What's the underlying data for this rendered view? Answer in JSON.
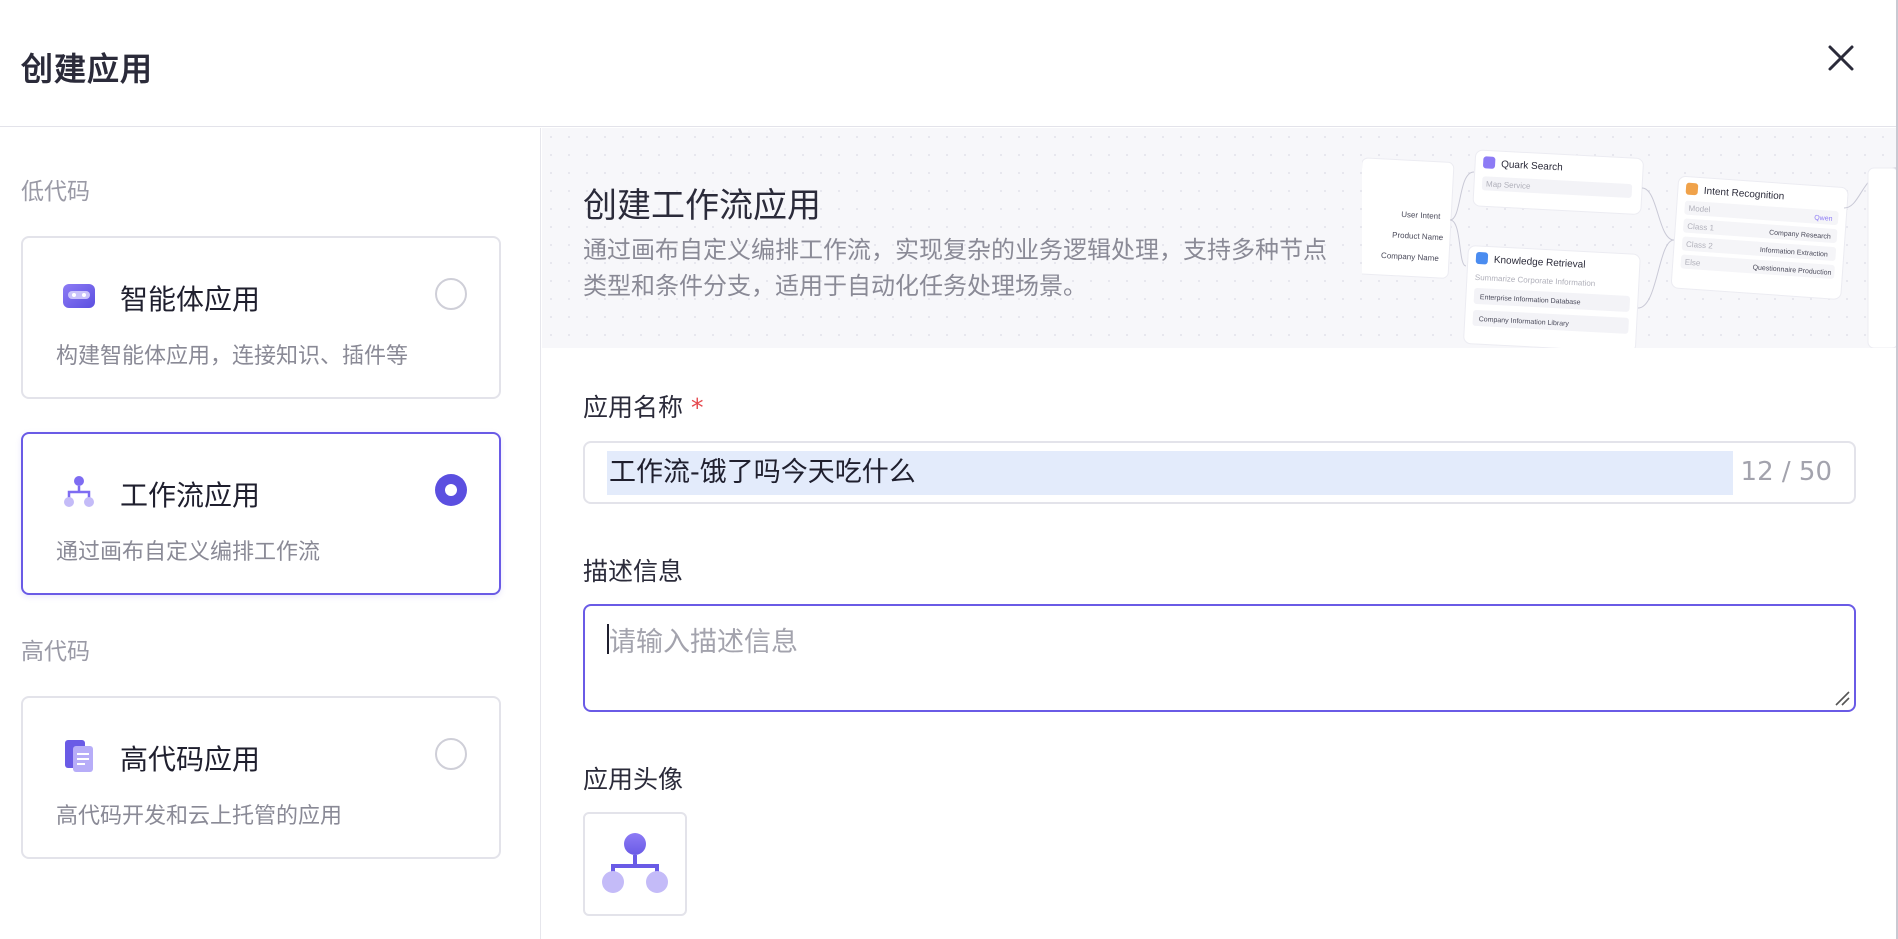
{
  "dialog": {
    "title": "创建应用",
    "close_icon": "close-icon"
  },
  "sidebar": {
    "low_code_label": "低代码",
    "high_code_label": "高代码",
    "cards": [
      {
        "title": "智能体应用",
        "desc": "构建智能体应用，连接知识、插件等",
        "icon": "agent-icon",
        "selected": false
      },
      {
        "title": "工作流应用",
        "desc": "通过画布自定义编排工作流",
        "icon": "workflow-icon",
        "selected": true
      },
      {
        "title": "高代码应用",
        "desc": "高代码开发和云上托管的应用",
        "icon": "code-document-icon",
        "selected": false
      }
    ]
  },
  "banner": {
    "title": "创建工作流应用",
    "desc": "通过画布自定义编排工作流，实现复杂的业务逻辑处理，支持多种节点类型和条件分支，适用于自动化任务处理场景。",
    "preview": {
      "inputs": [
        "User Intent",
        "Product Name",
        "Company Name"
      ],
      "quark_title": "Quark Search",
      "quark_sub": "Map Service",
      "knowledge_title": "Knowledge Retrieval",
      "knowledge_sub": "Summarize Corporate Information",
      "knowledge_items": [
        "Enterprise Information Database",
        "Company Information Library"
      ],
      "intent_title": "Intent Recognition",
      "intent_rows": [
        {
          "left": "Model",
          "right": "Qwen"
        },
        {
          "left": "Class 1",
          "right": "Company Research"
        },
        {
          "left": "Class 2",
          "right": "Information Extraction"
        },
        {
          "left": "Else",
          "right": "Questionnaire Production"
        }
      ]
    }
  },
  "form": {
    "name_label": "应用名称",
    "required_mark": "*",
    "name_value": "工作流-饿了吗今天吃什么",
    "name_counter": "12 / 50",
    "desc_label": "描述信息",
    "desc_placeholder": "请输入描述信息",
    "avatar_label": "应用头像",
    "avatar_icon": "workflow-avatar-icon"
  },
  "colors": {
    "accent": "#5b4fe0",
    "selection": "#e3ebfb",
    "required": "#e5484d"
  }
}
